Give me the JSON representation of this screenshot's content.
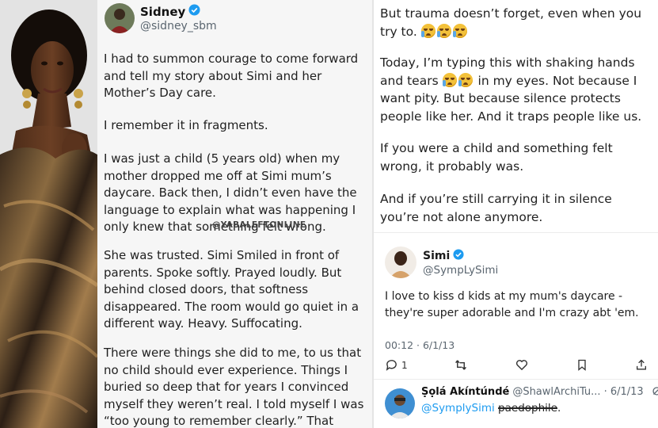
{
  "tweet_main": {
    "author_name": "Sidney",
    "author_handle": "@sidney_sbm",
    "paragraphs": [
      "I had to summon courage to come forward and tell my story about Simi and her Mother’s Day care.",
      "I remember it in fragments.",
      "I was just a child (5 years old) when my mother dropped me off at Simi mum’s daycare. Back then, I didn’t even have the language to explain what was happening I only knew that something felt wrong.",
      "She was trusted. Simi Smiled in front of parents. Spoke softly. Prayed loudly. But behind closed doors, that softness disappeared. The room would go quiet in a different way. Heavy. Suffocating.",
      "There were things she did to me, to us that no child should ever experience. Things I buried so deep that for years I convinced myself they weren’t real. I told myself I was “too young to remember clearly.” That maybe I misunderstood."
    ],
    "watermark": "@YABALEFTONLINE"
  },
  "tweet_continued": {
    "line1": "But trauma doesn’t forget, even when you try to.",
    "para2_a": "Today, I’m typing this with shaking hands and tears",
    "para2_b": "in my eyes. Not because I want pity. But because silence protects people like her. And it traps people like us.",
    "para3": "If you were a child and something felt wrong, it probably was.",
    "para4": "And if you’re still carrying it in silence you’re not alone anymore."
  },
  "quoted_tweet": {
    "author_name": "Simi",
    "author_handle": "@SympLySimi",
    "text": "I love to kiss d kids at my mum's daycare - they're super adorable and I'm crazy abt 'em.",
    "timestamp": "00:12 · 6/1/13",
    "reply_count": "1"
  },
  "reply": {
    "author_name": "Ṣọlá Akíntúndé",
    "author_handle": "@ShawlArchiTu...",
    "date": "· 6/1/13",
    "mention": "@SymplySimi",
    "struck_text": "paedophile",
    "trailing": "."
  },
  "colors": {
    "verified": "#1d9bf0",
    "emoji": "#f3c13a",
    "mid_background": "#f6f6f6",
    "text": "#1f1f1f",
    "secondary": "#5b6670"
  }
}
